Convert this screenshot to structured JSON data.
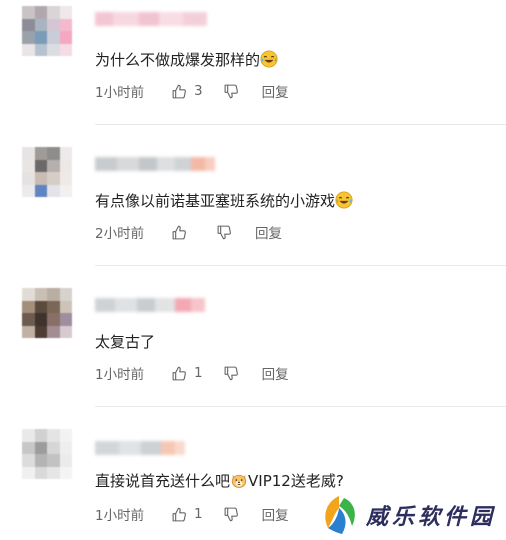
{
  "comments": [
    {
      "text": "为什么不做成爆发那样的",
      "time": "1小时前",
      "like_count": "3",
      "reply_label": "回复",
      "emoji": "laughing-crying"
    },
    {
      "text": "有点像以前诺基亚塞班系统的小游戏",
      "time": "2小时前",
      "like_count": "",
      "reply_label": "回复",
      "emoji": "laughing-crying"
    },
    {
      "text": "太复古了",
      "time": "1小时前",
      "like_count": "1",
      "reply_label": "回复",
      "emoji": ""
    },
    {
      "text_before": "直接说首充送什么吧",
      "text_after": "VIP12送老威?",
      "time": "1小时前",
      "like_count": "1",
      "reply_label": "回复",
      "emoji": "dog-face"
    }
  ],
  "watermark": {
    "text": "威乐软件园"
  },
  "colors": {
    "meta_gray": "#666666",
    "divider": "#e9e9e9",
    "watermark_navy": "#2d2d5e"
  }
}
